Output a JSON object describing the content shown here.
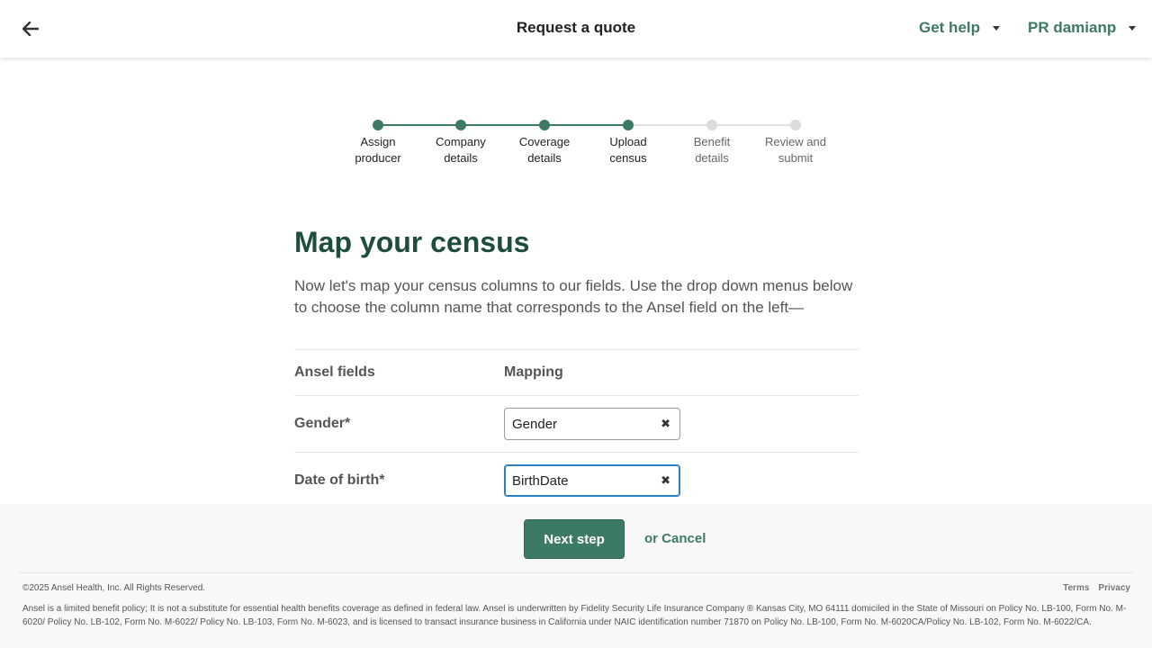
{
  "header": {
    "title": "Request a quote",
    "help_label": "Get help",
    "user_label": "PR damianp",
    "brand_color": "#3d7a63"
  },
  "stepper": {
    "steps": [
      {
        "label_line1": "Assign",
        "label_line2": "producer",
        "status": "done"
      },
      {
        "label_line1": "Company",
        "label_line2": "details",
        "status": "done"
      },
      {
        "label_line1": "Coverage",
        "label_line2": "details",
        "status": "done"
      },
      {
        "label_line1": "Upload",
        "label_line2": "census",
        "status": "current"
      },
      {
        "label_line1": "Benefit",
        "label_line2": "details",
        "status": "todo"
      },
      {
        "label_line1": "Review and",
        "label_line2": "submit",
        "status": "todo"
      }
    ]
  },
  "main": {
    "title": "Map your census",
    "intro": "Now let's map your census columns to our fields. Use the drop down menus below to choose the column name that corresponds to the Ansel field on the left—",
    "table": {
      "col_fields": "Ansel fields",
      "col_mapping": "Mapping",
      "rows": [
        {
          "field": "Gender*",
          "value": "Gender"
        },
        {
          "field": "Date of birth*",
          "value": "BirthDate"
        }
      ]
    }
  },
  "footer": {
    "next_label": "Next step",
    "cancel_label": "or Cancel",
    "copyright": "©2025 Ansel Health, Inc. All Rights Reserved.",
    "terms": "Terms",
    "privacy": "Privacy",
    "disclaimer": "Ansel is a limited benefit policy; It is not a substitute for essential health benefits coverage as defined in federal law. Ansel is underwritten by Fidelity Security Life Insurance Company ® Kansas City, MO 64111 domiciled in the State of Missouri on Policy No. LB-100, Form No. M-6020/ Policy No. LB-102, Form No. M-6022/ Policy No. LB-103, Form No. M-6023, and is licensed to transact insurance business in California under NAIC identification number 71870 on Policy No. LB-100, Form No. M-6020CA/Policy No. LB-102, Form No. M-6022/CA."
  }
}
